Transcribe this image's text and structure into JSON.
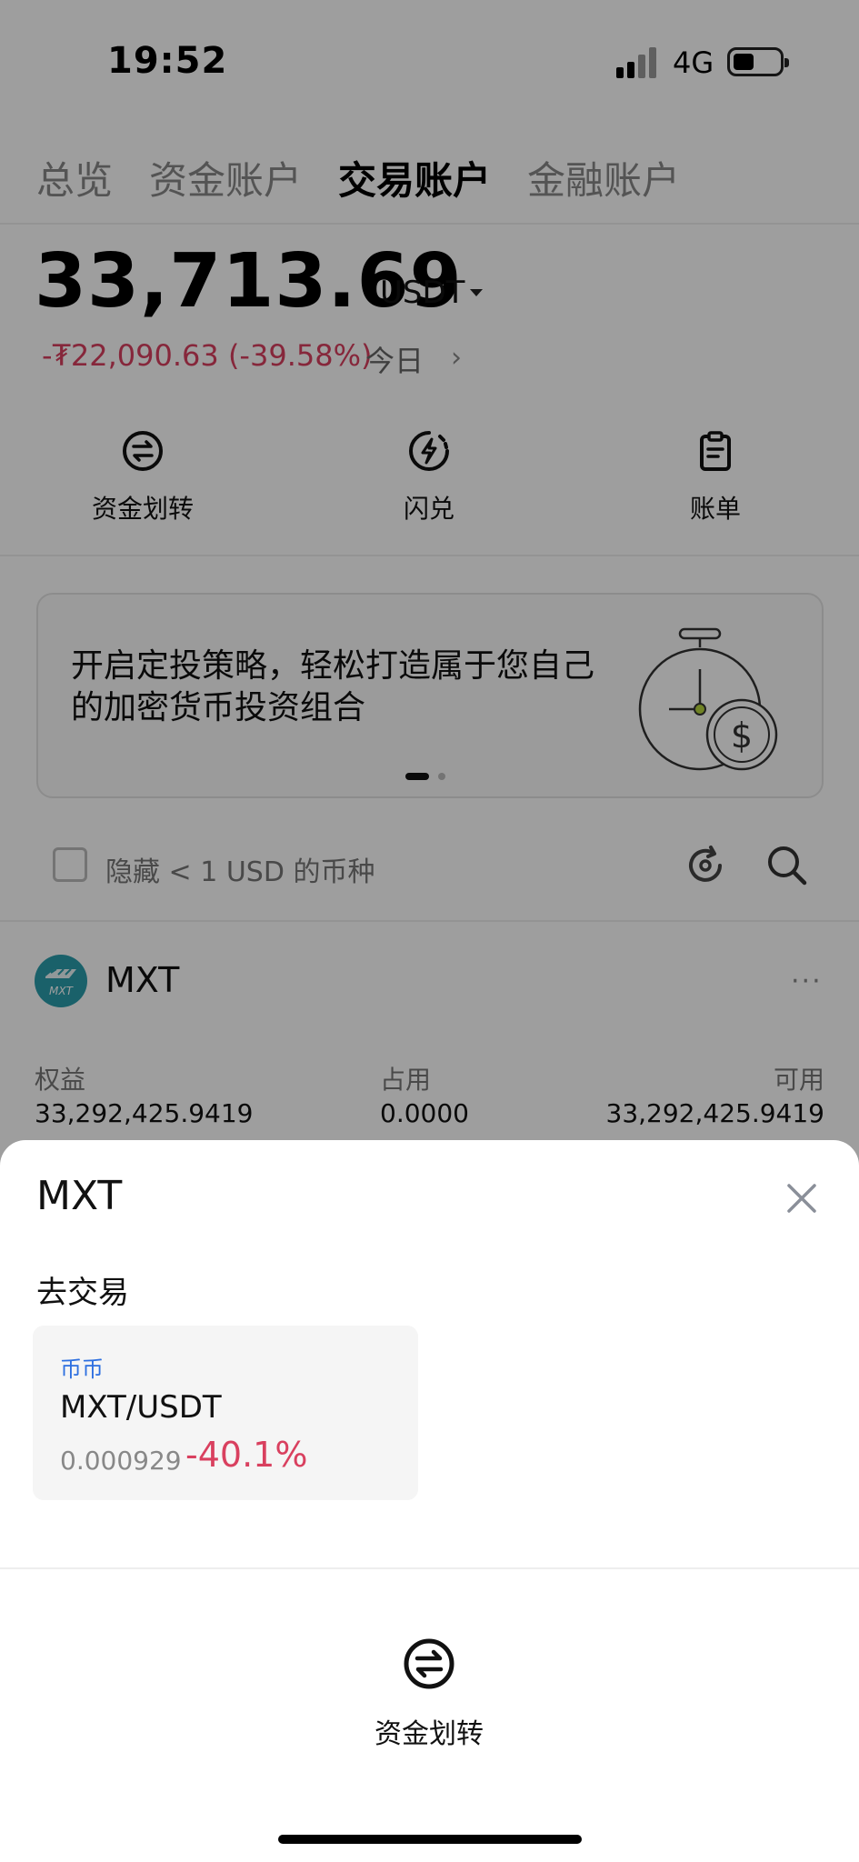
{
  "status_bar": {
    "time": "19:52",
    "network": "4G"
  },
  "tabs": [
    {
      "label": "总览",
      "active": false
    },
    {
      "label": "资金账户",
      "active": false
    },
    {
      "label": "交易账户",
      "active": true
    },
    {
      "label": "金融账户",
      "active": false
    }
  ],
  "balance": {
    "amount": "33,713.69",
    "currency": "USDT"
  },
  "pnl": {
    "text": "-₮22,090.63 (-39.58%)",
    "period": "今日"
  },
  "actions": [
    {
      "label": "资金划转",
      "icon": "transfer-icon"
    },
    {
      "label": "闪兑",
      "icon": "flash-swap-icon"
    },
    {
      "label": "账单",
      "icon": "bill-icon"
    }
  ],
  "banner": {
    "text": "开启定投策略，轻松打造属于您自己的加密货币投资组合",
    "icon": "stopwatch-coin-illustration"
  },
  "filter": {
    "hide_label": "隐藏 < 1 USD 的币种"
  },
  "coin": {
    "name": "MXT",
    "columns": [
      {
        "header": "权益",
        "value": "33,292,425.9419"
      },
      {
        "header": "占用",
        "value": "0.0000"
      },
      {
        "header": "可用",
        "value": "33,292,425.9419"
      }
    ]
  },
  "sheet": {
    "title": "MXT",
    "section_title": "去交易",
    "card": {
      "tag": "币币",
      "pair": "MXT/USDT",
      "price": "0.000929",
      "change": "-40.1%"
    },
    "action_label": "资金划转"
  },
  "colors": {
    "negative": "#d9405f",
    "link_blue": "#2d6fe0",
    "overlay": "rgba(0,0,0,0.38)"
  }
}
